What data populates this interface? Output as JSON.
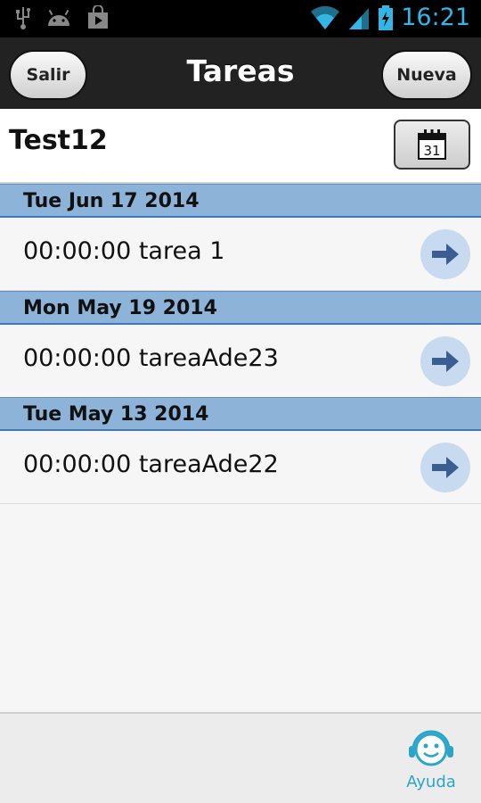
{
  "status_bar": {
    "time": "16:21",
    "icons": [
      "usb-icon",
      "android-icon",
      "play-store-icon",
      "wifi-icon",
      "signal-icon",
      "battery-icon"
    ]
  },
  "header": {
    "title": "Tareas",
    "left_button": "Salir",
    "right_button": "Nueva"
  },
  "project": {
    "name": "Test12",
    "calendar_day": "31"
  },
  "groups": [
    {
      "date": "Tue Jun 17 2014",
      "tasks": [
        {
          "label": "00:00:00 tarea 1"
        }
      ]
    },
    {
      "date": "Mon May 19 2014",
      "tasks": [
        {
          "label": "00:00:00 tareaAde23"
        }
      ]
    },
    {
      "date": "Tue May 13 2014",
      "tasks": [
        {
          "label": "00:00:00 tareaAde22"
        }
      ]
    }
  ],
  "footer": {
    "help_label": "Ayuda"
  },
  "colors": {
    "status_accent": "#33b5e5",
    "date_header_bg": "#8db3d9",
    "arrow": "#3b5e92",
    "arrow_circle": "#c7daf0",
    "help": "#2aa6c9"
  }
}
